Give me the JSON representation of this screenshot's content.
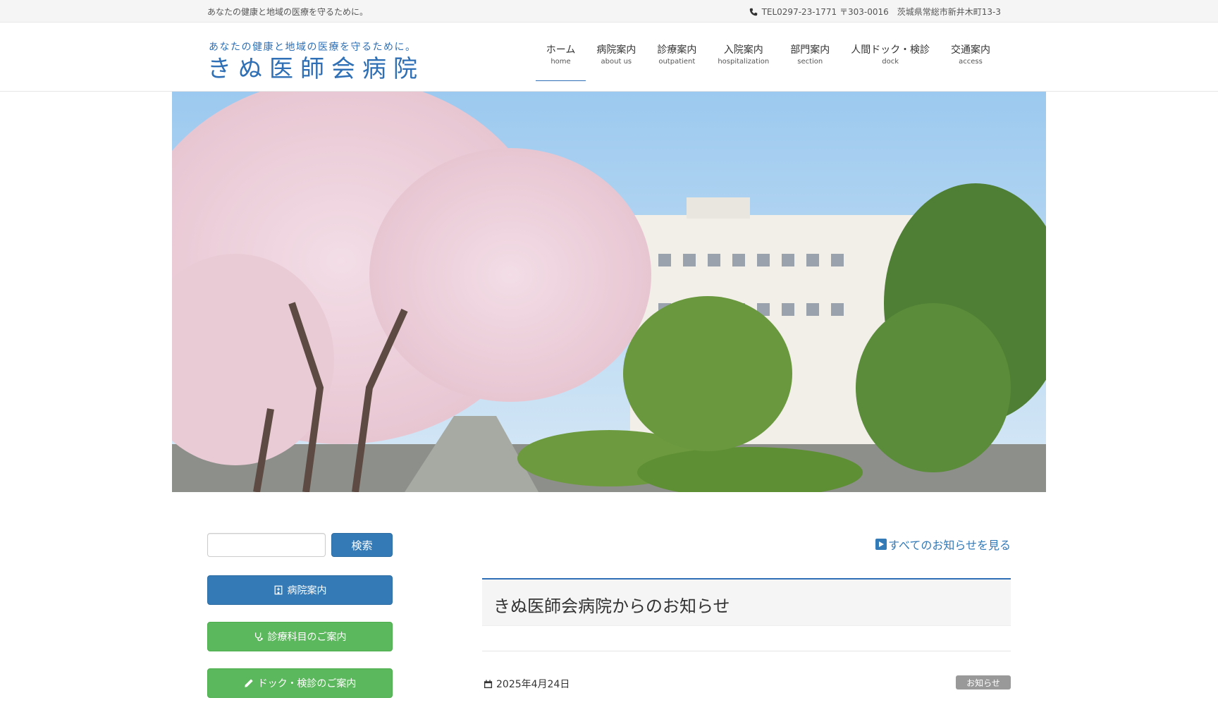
{
  "topbar": {
    "tagline": "あなたの健康と地域の医療を守るために。",
    "contact": "TEL0297-23-1771 〒303-0016　茨城県常総市新井木町13-3"
  },
  "logo": {
    "sub": "あなたの健康と地域の医療を守るために。",
    "main": "きぬ医師会病院"
  },
  "nav": [
    {
      "jp": "ホーム",
      "en": "home"
    },
    {
      "jp": "病院案内",
      "en": "about us"
    },
    {
      "jp": "診療案内",
      "en": "outpatient"
    },
    {
      "jp": "入院案内",
      "en": "hospitalization"
    },
    {
      "jp": "部門案内",
      "en": "section"
    },
    {
      "jp": "人間ドック・検診",
      "en": "dock"
    },
    {
      "jp": "交通案内",
      "en": "access"
    }
  ],
  "sidebar": {
    "search_button": "検索",
    "buttons": [
      {
        "label": "病院案内",
        "icon": "hospital-icon"
      },
      {
        "label": "診療科目のご案内",
        "icon": "stethoscope-icon"
      },
      {
        "label": "ドック・検診のご案内",
        "icon": "pencil-icon"
      }
    ]
  },
  "main": {
    "all_news_link": "すべてのお知らせを見る",
    "panel_title": "きぬ医師会病院からのお知らせ",
    "post": {
      "date": "2025年4月24日",
      "category": "お知らせ",
      "title": "…"
    }
  },
  "colors": {
    "accent_blue": "#337ab7",
    "logo_blue": "#2e6fb5",
    "green": "#5cb85c"
  }
}
